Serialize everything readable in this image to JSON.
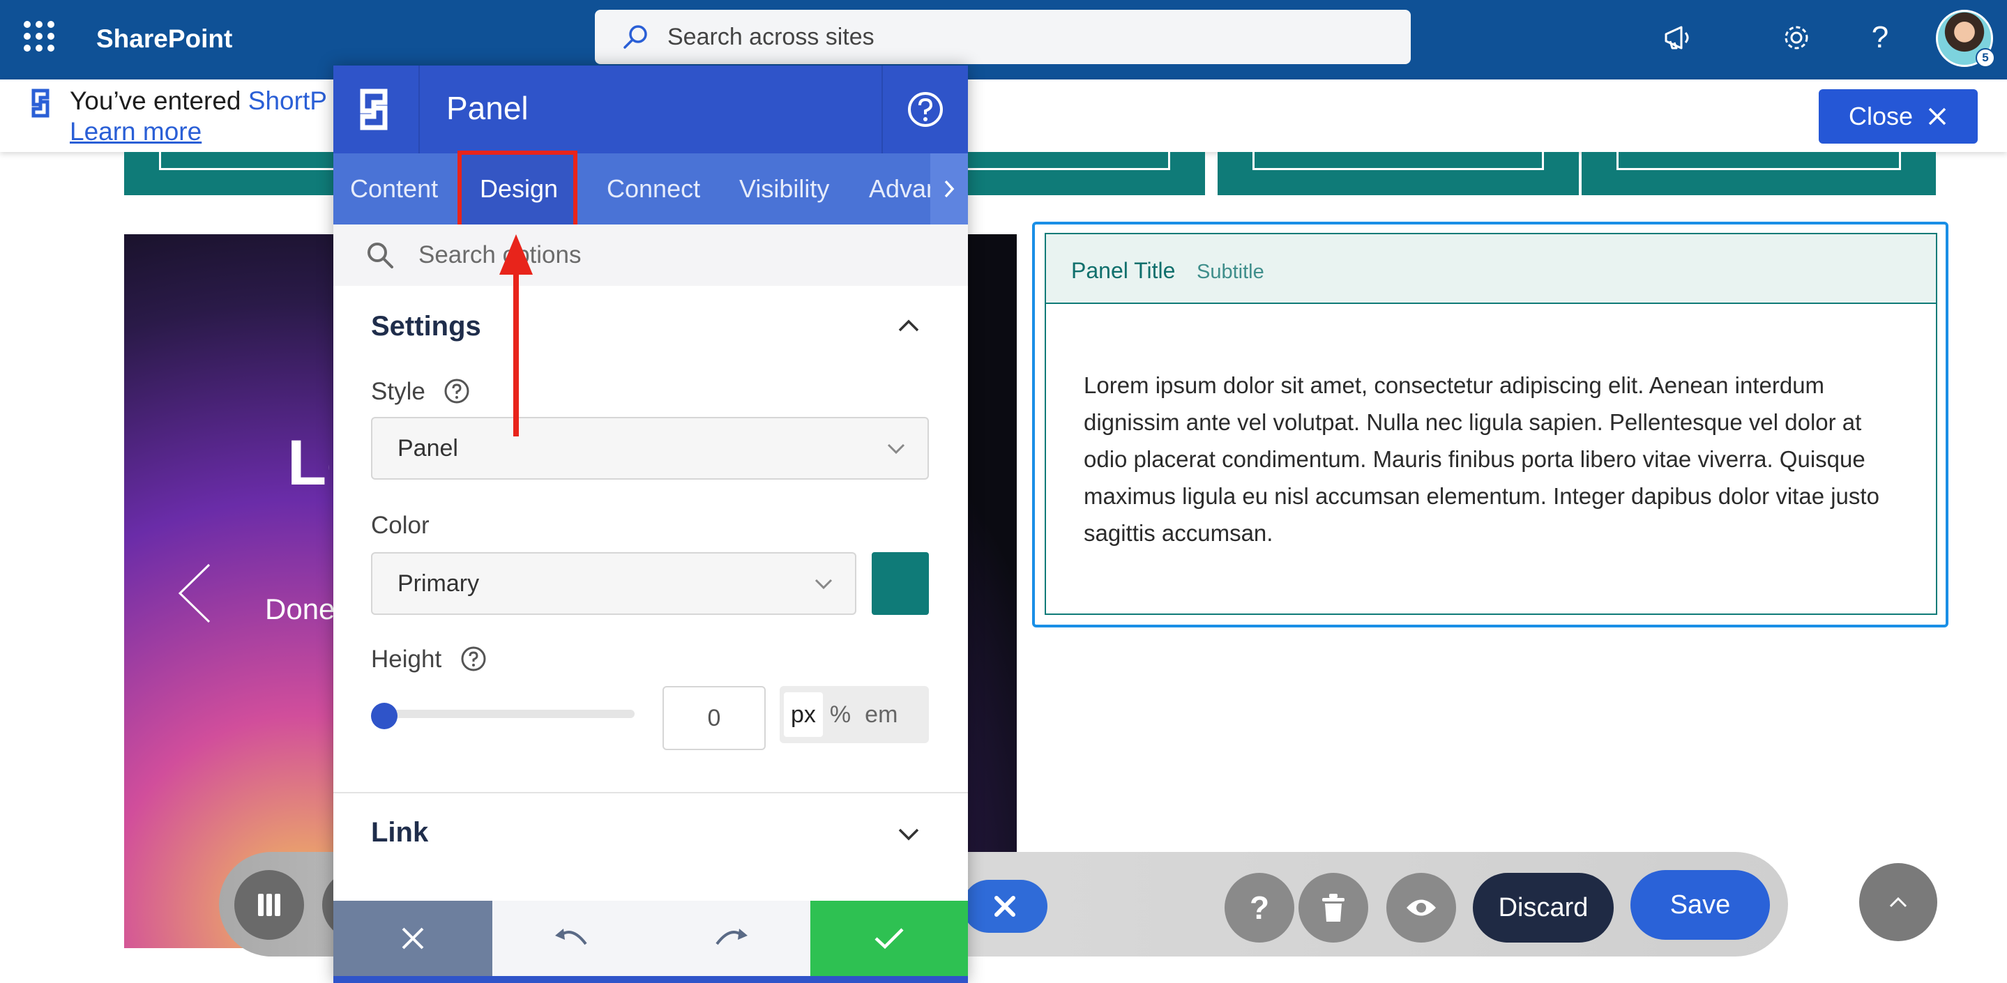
{
  "topbar": {
    "app_name": "SharePoint",
    "search_placeholder": "Search across sites",
    "icons": [
      "app-launcher-icon",
      "search-icon",
      "megaphone-icon",
      "gear-icon",
      "help-icon"
    ],
    "avatar_badge": "5"
  },
  "notice": {
    "text_prefix": "You’ve entered ",
    "brand": "ShortP",
    "learn_more": "Learn more",
    "close_label": "Close"
  },
  "carousel": {
    "title_fragment": "Le",
    "subtitle_fragment": "Done"
  },
  "content_panel": {
    "title": "Panel Title",
    "subtitle": "Subtitle",
    "body": "Lorem ipsum dolor sit amet, consectetur adipiscing elit. Aenean interdum dignissim ante vel volutpat. Nulla nec ligula sapien. Pellentesque vel dolor at odio placerat condimentum. Mauris finibus porta libero vitae viverra. Quisque maximus ligula eu nisl accumsan elementum. Integer dapibus dolor vitae justo sagittis accumsan."
  },
  "editor": {
    "title": "Panel",
    "tabs": [
      "Content",
      "Design",
      "Connect",
      "Visibility",
      "Advan"
    ],
    "active_tab": "Design",
    "search_placeholder": "Search options",
    "settings_heading": "Settings",
    "style_label": "Style",
    "style_value": "Panel",
    "color_label": "Color",
    "color_value": "Primary",
    "color_swatch": "#0f7b78",
    "height_label": "Height",
    "height_value": "0",
    "units": [
      "px",
      "%",
      "em"
    ],
    "active_unit": "px",
    "link_heading": "Link"
  },
  "toolbar": {
    "discard_label": "Discard",
    "save_label": "Save"
  },
  "colors": {
    "topbar": "#0f5196",
    "teal": "#0f7b78",
    "editor_header": "#2f54c9",
    "highlight": "#e8241b",
    "apply": "#2ec152"
  }
}
